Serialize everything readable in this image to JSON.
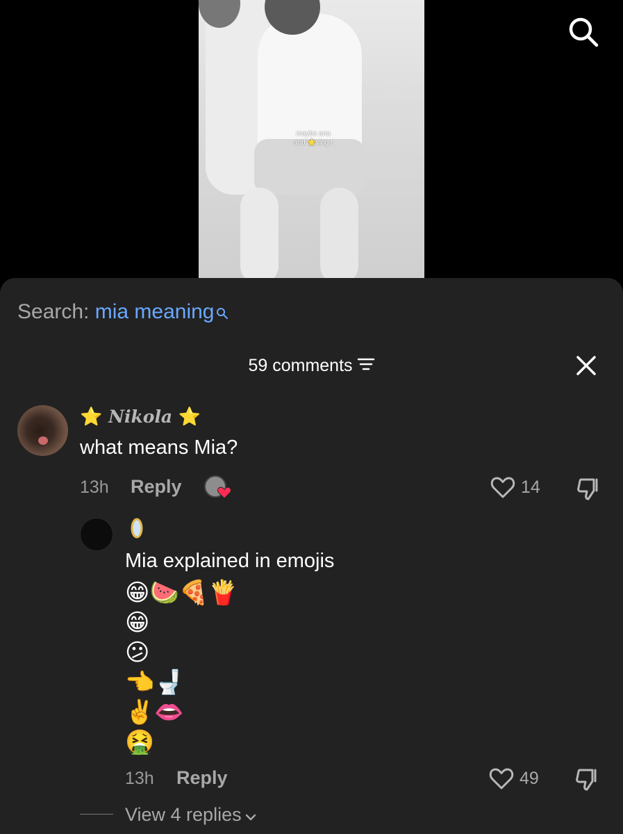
{
  "video": {
    "caption_line1": "maybe ana",
    "caption_line2": "and ⭐️ving !"
  },
  "search": {
    "prefix": "Search: ",
    "query": "mia meaning"
  },
  "comments": {
    "count_label": "59 comments"
  },
  "comment1": {
    "star": "⭐",
    "username": "Nikola",
    "text": "what means Mia?",
    "time": "13h",
    "reply_label": "Reply",
    "likes": "14"
  },
  "comment2": {
    "text": "Mia explained in emojis",
    "emoji_lines": [
      "😁🍉🍕🍟",
      "😁",
      "😕",
      "👈🚽",
      "✌️👄",
      "🤮"
    ],
    "time": "13h",
    "reply_label": "Reply",
    "likes": "49"
  },
  "view_replies_label": "View 4 replies",
  "colors": {
    "sheet_bg": "#222222",
    "search_query": "#6aa8ff",
    "liked_heart": "#ff2d55",
    "muted_text": "#a8a8a8"
  },
  "icons": [
    "search-icon",
    "sort-icon",
    "close-icon",
    "heart-icon",
    "dislike-icon",
    "chevron-down-icon",
    "mirror-icon"
  ]
}
